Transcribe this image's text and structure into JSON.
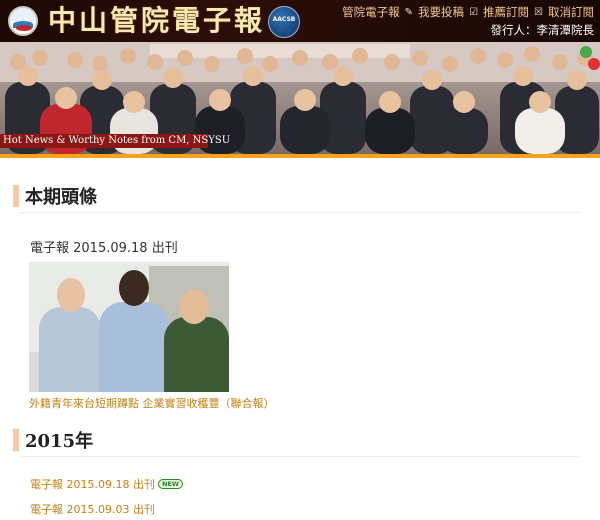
{
  "header": {
    "site_title": "中山管院電子報",
    "aacsb_label": "AACSB",
    "nav": [
      {
        "label": "管院電子報",
        "icon": "pencil-icon"
      },
      {
        "label": "我要投稿",
        "icon": "checkbox-icon"
      },
      {
        "label": "推薦訂閱",
        "icon": "checkbox-icon"
      },
      {
        "label": "取消訂閱",
        "icon": "none"
      }
    ],
    "publisher": "發行人：李清潭院長"
  },
  "banner": {
    "caption": "Hot News & Worthy Notes from CM, NSYSU"
  },
  "headlines": {
    "title": "本期頭條",
    "issue": "電子報 2015.09.18 出刊",
    "photo_caption": "外籍青年來台短期蹲點 企業實習收穫豐（聯合報）"
  },
  "archive": {
    "title": "2015年",
    "items": [
      {
        "label": "電子報 2015.09.18 出刊",
        "badge": "NEW"
      },
      {
        "label": "電子報 2015.09.03 出刊",
        "badge": ""
      }
    ]
  },
  "colors": {
    "header_bg": "#2c0e08",
    "title_text": "#fbe9b0",
    "nav_text": "#f2c88a",
    "stripe": "#f6a21a",
    "link": "#c58214",
    "caption_bg": "#8b1613",
    "section_bar": "#f6c9a8"
  }
}
